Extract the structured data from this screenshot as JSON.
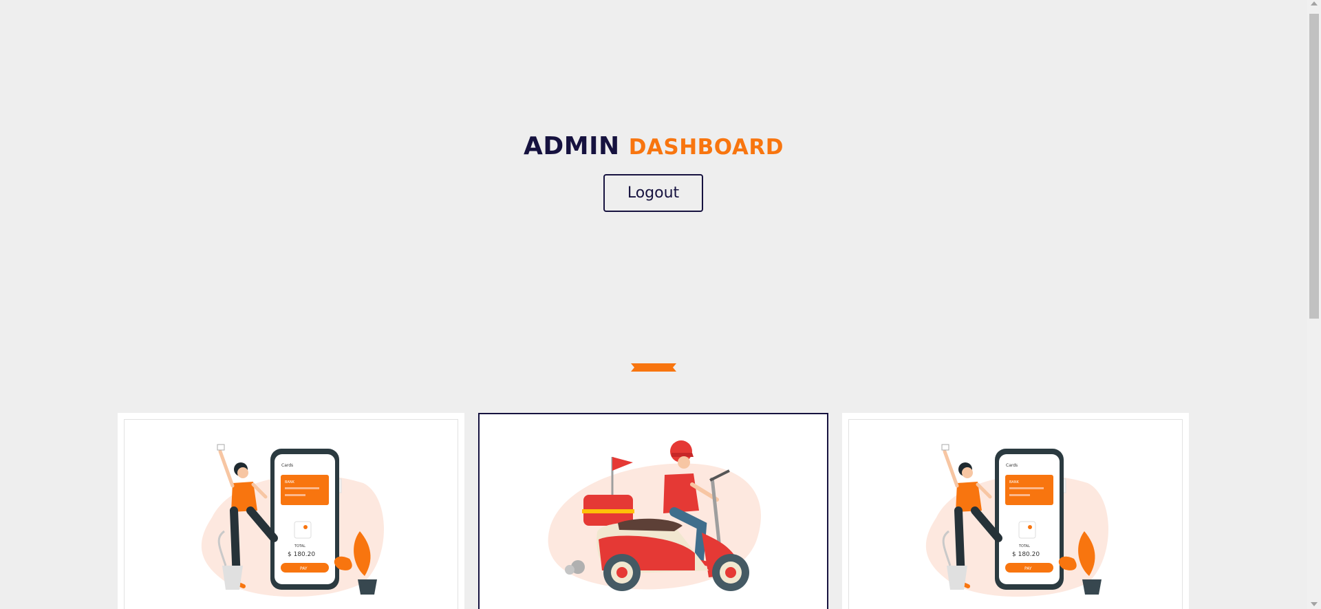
{
  "header": {
    "title_part1": "ADMIN",
    "title_part2": "DASHBOARD",
    "logout_label": "Logout"
  },
  "colors": {
    "primary": "#16123f",
    "accent": "#f8750f",
    "background": "#eeeeee"
  },
  "cards": [
    {
      "illustration": "woman-mobile-payment-illustration",
      "phone_title": "Cards",
      "card_label": "BANK",
      "total_label": "TOTAL",
      "amount": "$ 180.20",
      "pay_label": "PAY"
    },
    {
      "illustration": "delivery-scooter-illustration"
    },
    {
      "illustration": "woman-mobile-payment-illustration",
      "phone_title": "Cards",
      "card_label": "BANK",
      "total_label": "TOTAL",
      "amount": "$ 180.20",
      "pay_label": "PAY"
    }
  ]
}
